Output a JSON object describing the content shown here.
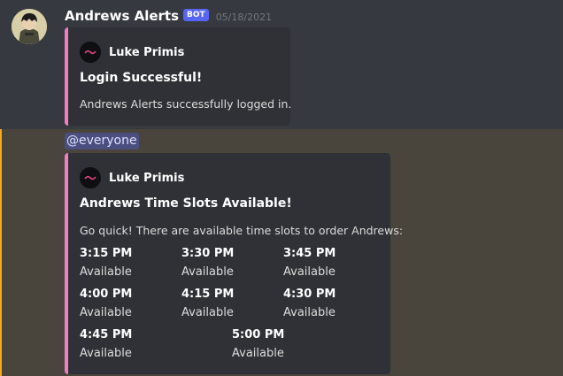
{
  "message": {
    "username": "Andrews Alerts",
    "bot_tag": "BOT",
    "timestamp": "05/18/2021",
    "avatar_icon": "avatar-icon"
  },
  "embed_login": {
    "accent_color": "#f07ec6",
    "author": "Luke Primis",
    "title": "Login Successful!",
    "description": "Andrews Alerts successfully logged in."
  },
  "mention_message": {
    "mention": "@everyone",
    "highlight_color": "#49443c",
    "mention_bar_color": "#faa81a"
  },
  "embed_slots": {
    "accent_color": "#f07ec6",
    "author": "Luke Primis",
    "title": "Andrews Time Slots Available!",
    "description": "Go quick! There are available time slots to order Andrews:",
    "fields": [
      {
        "name": "3:15 PM",
        "value": "Available"
      },
      {
        "name": "3:30 PM",
        "value": "Available"
      },
      {
        "name": "3:45 PM",
        "value": "Available"
      },
      {
        "name": "4:00 PM",
        "value": "Available"
      },
      {
        "name": "4:15 PM",
        "value": "Available"
      },
      {
        "name": "4:30 PM",
        "value": "Available"
      },
      {
        "name": "4:45 PM",
        "value": "Available"
      },
      {
        "name": "5:00 PM",
        "value": "Available"
      }
    ]
  }
}
